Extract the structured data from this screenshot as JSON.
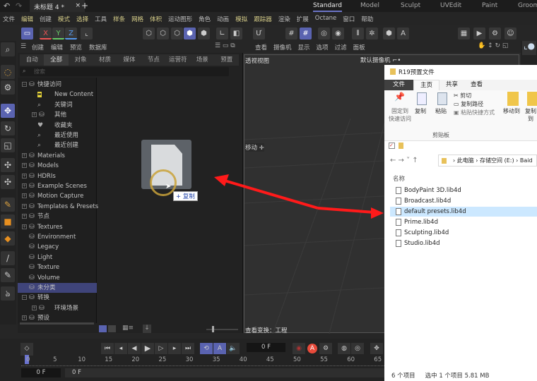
{
  "top": {
    "doc_tab": "未标题 4 *",
    "close": "×",
    "add": "+",
    "layouts": [
      "Standard",
      "Model",
      "Sculpt",
      "UVEdit",
      "Paint",
      "Groom"
    ],
    "active_layout": "Standard"
  },
  "menu": [
    "文件",
    "编辑",
    "创建",
    "模式",
    "选择",
    "工具",
    "样条",
    "网格",
    "体积",
    "运动图形",
    "角色",
    "动画",
    "模拟",
    "跟踪器",
    "渲染",
    "扩展",
    "Octane",
    "窗口",
    "帮助"
  ],
  "toolbar": {
    "axes": [
      "X",
      "Y",
      "Z"
    ]
  },
  "content_browser": {
    "menu": [
      "创建",
      "编辑",
      "预览",
      "数据库"
    ],
    "tabs": [
      "自动",
      "全部",
      "对象",
      "材质",
      "媒体",
      "节点",
      "运营符",
      "场景",
      "预置"
    ],
    "active_tab": "全部",
    "search_placeholder": "搜索",
    "tree": [
      {
        "label": "快捷访问",
        "icon": "db",
        "exp": "minus",
        "lvl": 0
      },
      {
        "label": "New Content",
        "icon": "new",
        "lvl": 1
      },
      {
        "label": "关键词",
        "icon": "search",
        "lvl": 1
      },
      {
        "label": "其他",
        "icon": "db",
        "exp": "plus",
        "lvl": 1
      },
      {
        "label": "收藏夹",
        "icon": "heart",
        "lvl": 1
      },
      {
        "label": "最近使用",
        "icon": "search",
        "lvl": 1
      },
      {
        "label": "最近创建",
        "icon": "search",
        "lvl": 1
      },
      {
        "label": "Materials",
        "icon": "db",
        "exp": "plus",
        "lvl": 0
      },
      {
        "label": "Models",
        "icon": "db",
        "exp": "plus",
        "lvl": 0
      },
      {
        "label": "HDRIs",
        "icon": "db",
        "exp": "plus",
        "lvl": 0
      },
      {
        "label": "Example Scenes",
        "icon": "db",
        "exp": "plus",
        "lvl": 0
      },
      {
        "label": "Motion Capture",
        "icon": "db",
        "exp": "plus",
        "lvl": 0
      },
      {
        "label": "Templates & Presets",
        "icon": "db",
        "exp": "plus",
        "lvl": 0
      },
      {
        "label": "节点",
        "icon": "db",
        "exp": "plus",
        "lvl": 0
      },
      {
        "label": "Textures",
        "icon": "db",
        "exp": "plus",
        "lvl": 0
      },
      {
        "label": "Environment",
        "icon": "db",
        "lvl": 0
      },
      {
        "label": "Legacy",
        "icon": "db",
        "lvl": 0
      },
      {
        "label": "Light",
        "icon": "db",
        "lvl": 0
      },
      {
        "label": "Texture",
        "icon": "db",
        "lvl": 0
      },
      {
        "label": "Volume",
        "icon": "db",
        "lvl": 0
      },
      {
        "label": "未分类",
        "icon": "db",
        "lvl": 0,
        "selected": true
      },
      {
        "label": "转换",
        "icon": "db",
        "exp": "minus",
        "lvl": 0
      },
      {
        "label": "环境场景",
        "icon": "db",
        "exp": "plus",
        "lvl": 1
      },
      {
        "label": "预设",
        "icon": "db",
        "exp": "plus",
        "lvl": 0
      }
    ],
    "drag_tooltip": "+ 复制"
  },
  "viewport": {
    "menu": [
      "查看",
      "摄像机",
      "显示",
      "选项",
      "过滤",
      "面板"
    ],
    "view_name": "透视视图",
    "camera": "默认摄像机 ⌐•",
    "move_label": "移动 ✛",
    "transform": "查看变换：工程"
  },
  "explorer": {
    "title": "R19预置文件",
    "tabs": [
      "文件",
      "主页",
      "共享",
      "查看"
    ],
    "active_tab": "主页",
    "ribbon": {
      "pin": "固定到\n快速访问",
      "copy": "复制",
      "paste": "粘贴",
      "cut": "剪切",
      "copy_path": "复制路径",
      "paste_shortcut": "粘贴快捷方式",
      "group": "剪贴板",
      "move_to": "移动到",
      "copy_to": "复制到"
    },
    "address": [
      "此电脑",
      "存储空间 (E:)",
      "Baid"
    ],
    "column": "名称",
    "files": [
      "BodyPaint 3D.lib4d",
      "Broadcast.lib4d",
      "default presets.lib4d",
      "Prime.lib4d",
      "Sculpting.lib4d",
      "Studio.lib4d"
    ],
    "selected_file": "default presets.lib4d",
    "status": {
      "count": "6 个项目",
      "selected": "选中 1 个项目  5.81 MB"
    }
  },
  "timeline": {
    "current_frame": "0 F",
    "ticks": [
      "0",
      "5",
      "10",
      "15",
      "20",
      "25",
      "30",
      "35",
      "40",
      "45",
      "50",
      "55",
      "60",
      "65"
    ],
    "start": "0 F",
    "end": "0 F"
  },
  "colors": {
    "accent": "#5a63b0",
    "arrow": "#ff1a1a",
    "selection": "#3f447a",
    "explorer_selection": "#cce8ff"
  }
}
